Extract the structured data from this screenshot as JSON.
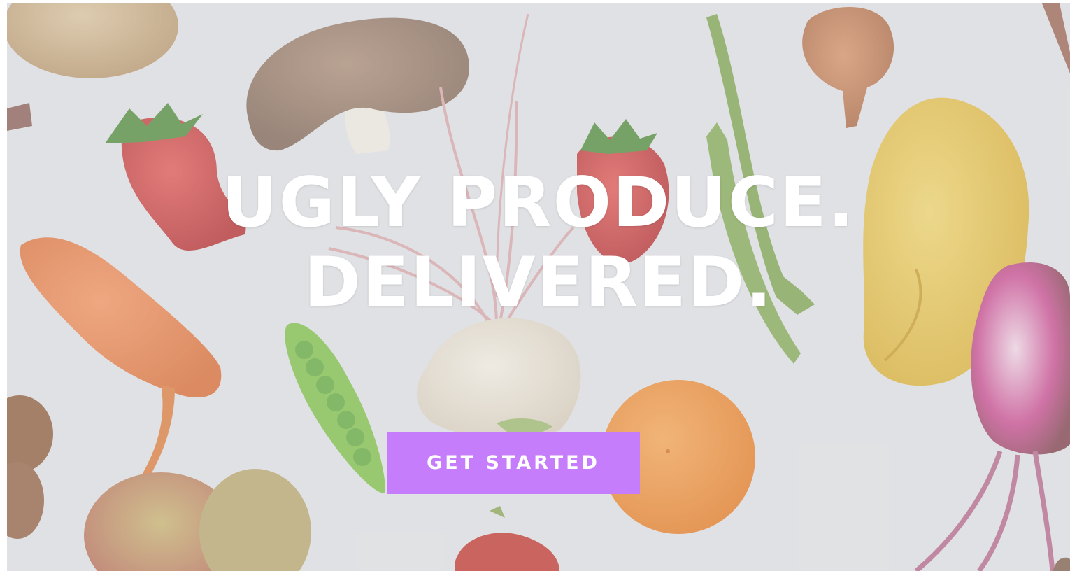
{
  "hero": {
    "headline_line1": "UGLY PRODUCE.",
    "headline_line2": "DELIVERED.",
    "cta_label": "GET STARTED",
    "cta_color": "#c57dfb",
    "background_image": "flat-lay-ugly-vegetables-photo"
  }
}
